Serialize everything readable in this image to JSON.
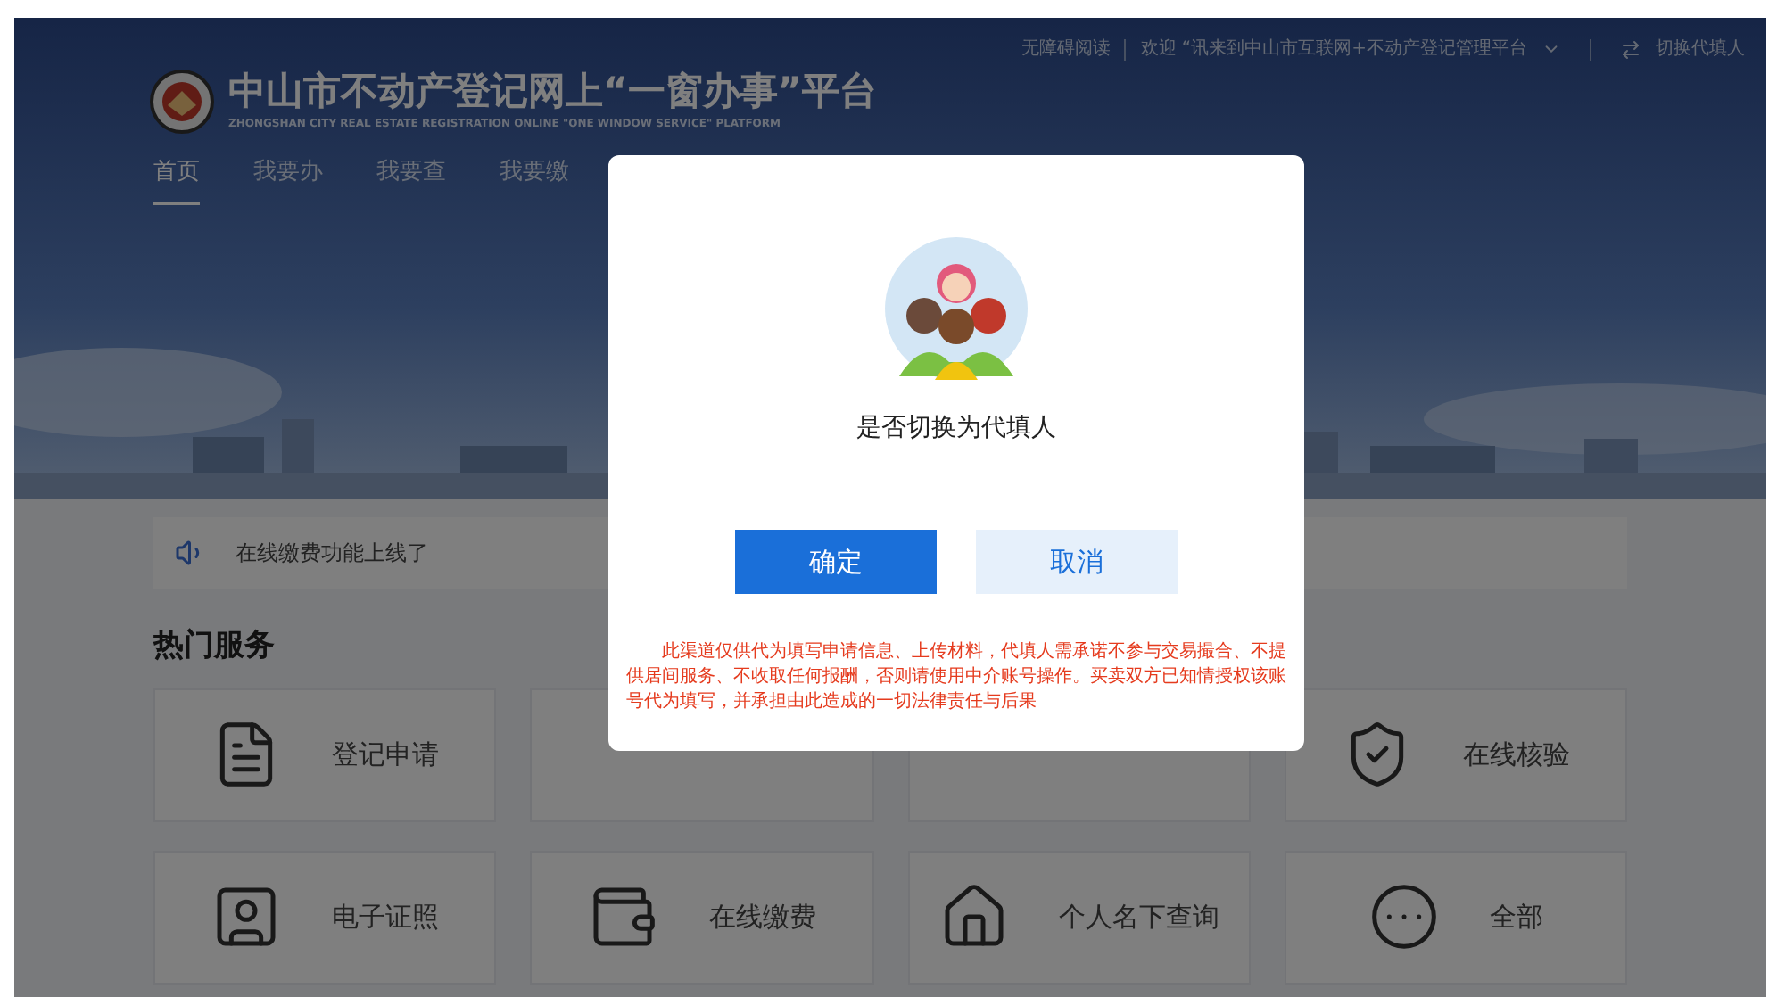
{
  "top_bar": {
    "accessibility_link": "无障碍阅读",
    "welcome_text": "欢迎 “讯来到中山市互联网+不动产登记管理平台",
    "switch_link": "切换代填人"
  },
  "header": {
    "title": "中山市不动产登记网上“一窗办事”平台",
    "subtitle": "ZHONGSHAN CITY REAL ESTATE REGISTRATION ONLINE \"ONE WINDOW SERVICE\" PLATFORM"
  },
  "nav": [
    {
      "label": "首页",
      "selected": true
    },
    {
      "label": "我要办",
      "selected": false
    },
    {
      "label": "我要查",
      "selected": false
    },
    {
      "label": "我要缴",
      "selected": false
    }
  ],
  "notice": {
    "text": "在线缴费功能上线了"
  },
  "section_title": "热门服务",
  "services": [
    {
      "label": "登记申请",
      "kind": "form"
    },
    {
      "kind": "covered"
    },
    {
      "kind": "covered"
    },
    {
      "label": "在线核验",
      "kind": "shield"
    },
    {
      "label": "电子证照",
      "kind": "id"
    },
    {
      "label": "在线缴费",
      "kind": "moneybag"
    },
    {
      "label": "个人名下查询",
      "kind": "house"
    },
    {
      "label": "全部",
      "kind": "more"
    }
  ],
  "dialog": {
    "message": "是否切换为代填人",
    "buttons": [
      {
        "label": "确定",
        "kind": "primary"
      },
      {
        "label": "取消",
        "kind": "secondary"
      }
    ],
    "disclaimer": "此渠道仅供代为填写申请信息、上传材料，代填人需承诺不参与交易撮合、不提供居间服务、不收取任何报酬，否则请使用中介账号操作。买卖双方已知情授权该账号代为填写，并承担由此造成的一切法律责任与后果"
  }
}
